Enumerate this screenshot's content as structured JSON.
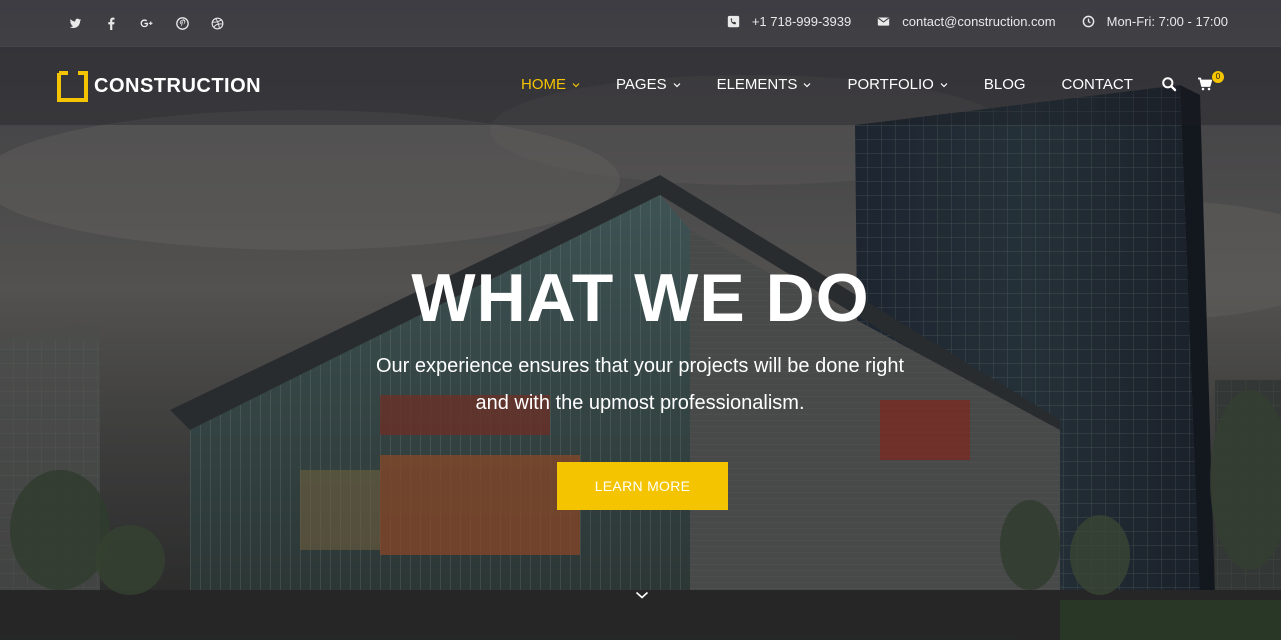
{
  "colors": {
    "accent": "#f5c400",
    "text": "#ffffff",
    "topbar_text": "#e9e9e9"
  },
  "topbar": {
    "socials": [
      {
        "icon": "twitter-icon"
      },
      {
        "icon": "facebook-icon"
      },
      {
        "icon": "google-plus-icon"
      },
      {
        "icon": "pinterest-icon"
      },
      {
        "icon": "dribbble-icon"
      }
    ],
    "phone": "+1 718-999-3939",
    "email": "contact@construction.com",
    "hours": "Mon-Fri: 7:00 - 17:00"
  },
  "nav": {
    "logo_text": "CONSTRUCTION",
    "items": [
      {
        "label": "HOME",
        "active": true,
        "has_dropdown": true
      },
      {
        "label": "PAGES",
        "active": false,
        "has_dropdown": true
      },
      {
        "label": "ELEMENTS",
        "active": false,
        "has_dropdown": true
      },
      {
        "label": "PORTFOLIO",
        "active": false,
        "has_dropdown": true
      },
      {
        "label": "BLOG",
        "active": false,
        "has_dropdown": false
      },
      {
        "label": "CONTACT",
        "active": false,
        "has_dropdown": false
      }
    ],
    "cart_count": "0",
    "search_icon": "search-icon",
    "cart_icon": "cart-icon"
  },
  "hero": {
    "title": "WHAT WE DO",
    "subtitle_line1": "Our experience ensures that your projects will be done right",
    "subtitle_line2": "and with the upmost professionalism.",
    "cta_label": "LEARN MORE",
    "scroll_icon": "chevron-down-icon"
  }
}
